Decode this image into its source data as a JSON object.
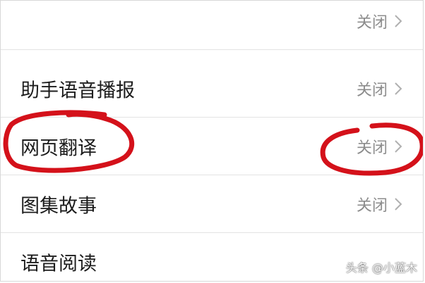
{
  "settings": {
    "rows": [
      {
        "label": "",
        "value": "关闭"
      },
      {
        "label": "助手语音播报",
        "value": "关闭"
      },
      {
        "label": "网页翻译",
        "value": "关闭"
      },
      {
        "label": "图集故事",
        "value": "关闭"
      },
      {
        "label": "语音阅读",
        "value": ""
      }
    ]
  },
  "icons": {
    "row_chevron": "chevron-right-icon"
  },
  "annotation": {
    "circle_color": "#d4111a"
  },
  "watermark": {
    "text": "头条 @小蓝木"
  }
}
